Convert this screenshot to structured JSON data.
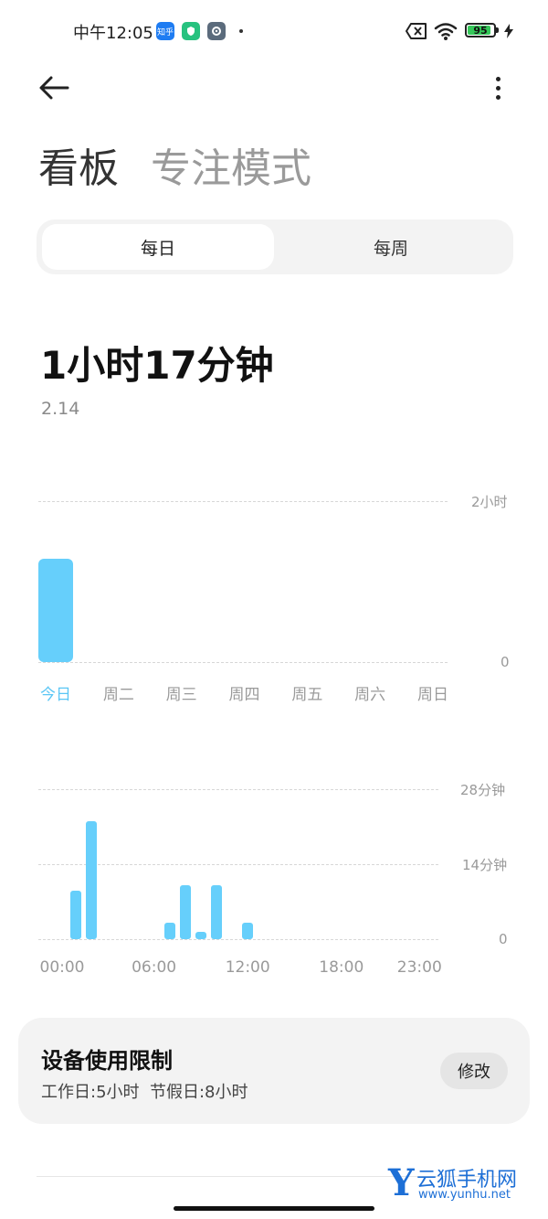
{
  "status_bar": {
    "time": "中午12:05",
    "app_icons": [
      {
        "icon": "zhihu-app-icon",
        "label": "知乎",
        "color": "#1e7cf2"
      },
      {
        "icon": "security-app-icon",
        "color": "#27c27f"
      },
      {
        "icon": "settings-app-icon",
        "color": "#5b6b7c"
      }
    ],
    "battery": "95",
    "battery_level": 0.95
  },
  "header": {
    "title": "看板",
    "subtitle": "专注模式"
  },
  "tabs": [
    {
      "label": "每日",
      "active": true
    },
    {
      "label": "每周",
      "active": false
    }
  ],
  "summary": {
    "total": "1小时17分钟",
    "date": "2.14"
  },
  "weekly_chart": {
    "chart_data": {
      "type": "bar",
      "categories": [
        "今日",
        "周二",
        "周三",
        "周四",
        "周五",
        "周六",
        "周日"
      ],
      "values": [
        77,
        0,
        0,
        0,
        0,
        0,
        0
      ],
      "unit": "minutes",
      "ylim": [
        0,
        120
      ],
      "ytick_labels": [
        "2小时",
        "0"
      ],
      "active_category": "今日",
      "grid": true
    }
  },
  "hourly_chart": {
    "chart_data": {
      "type": "bar",
      "x": [
        1,
        2,
        7,
        8,
        9,
        10,
        12
      ],
      "values": [
        9,
        22,
        3,
        10,
        1,
        10,
        3
      ],
      "unit": "minutes",
      "ylim": [
        0,
        28
      ],
      "ytick_labels": [
        "28分钟",
        "14分钟",
        "0"
      ],
      "xtick_labels": [
        "00:00",
        "06:00",
        "12:00",
        "18:00",
        "23:00"
      ],
      "grid": true
    }
  },
  "limit_card": {
    "title": "设备使用限制",
    "subtitle": "工作日:5小时  节假日:8小时",
    "button": "修改"
  },
  "watermark": {
    "letter": "Y",
    "name": "云狐手机网",
    "url": "www.yunhu.net"
  },
  "colors": {
    "accent": "#66cffb",
    "accent_text": "#5ac6f5",
    "card_bg": "#f3f3f3",
    "watermark": "#1d6fd6"
  }
}
